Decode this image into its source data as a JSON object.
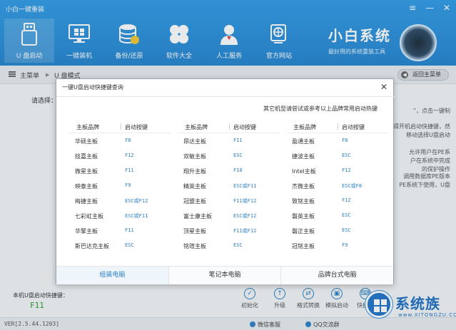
{
  "window": {
    "title": "小白一键重装",
    "controls": [
      "≡",
      "—",
      "✕"
    ]
  },
  "nav": [
    {
      "label": "U 盘启动",
      "icon": "usb-drive-icon",
      "active": true
    },
    {
      "label": "一键装机",
      "icon": "monitor-install-icon",
      "active": false
    },
    {
      "label": "备份/还原",
      "icon": "database-backup-icon",
      "active": false
    },
    {
      "label": "软件大全",
      "icon": "app-grid-icon",
      "active": false
    },
    {
      "label": "人工服务",
      "icon": "support-agent-icon",
      "active": false
    },
    {
      "label": "官方网站",
      "icon": "globe-icon",
      "active": false
    }
  ],
  "brand": {
    "name": "小白系统",
    "tagline": "最好用的系统重装工具"
  },
  "breadcrumb": {
    "home": "主菜单",
    "sep": "▶",
    "current": "U 盘模式",
    "back_label": "返回主菜单"
  },
  "main": {
    "select_label": "请选择：",
    "side_texts": [
      "”，点击一键制",
      "得开机启动快捷键，然",
      "移动选择U盘启动",
      "允许用户在PE系",
      "户在系统中完成",
      "的保护操作",
      "调用数据库PE版本",
      "PE系统下使用，U盘"
    ]
  },
  "modal": {
    "title": "一键U盘启动快捷键查询",
    "close": "✕",
    "note": "其它机型请尝试或参考以上品牌常用启动热键",
    "headers": {
      "brand": "主板品牌",
      "key": "启动按键"
    },
    "columns": [
      [
        {
          "brand": "华硕主板",
          "key": "F8"
        },
        {
          "brand": "技嘉主板",
          "key": "F12"
        },
        {
          "brand": "微星主板",
          "key": "F11"
        },
        {
          "brand": "映泰主板",
          "key": "F9"
        },
        {
          "brand": "梅捷主板",
          "key": "ESC或F12"
        },
        {
          "brand": "七彩虹主板",
          "key": "ESC或F11"
        },
        {
          "brand": "华擎主板",
          "key": "F11"
        },
        {
          "brand": "斯巴达克主板",
          "key": "ESC"
        }
      ],
      [
        {
          "brand": "昂达主板",
          "key": "F11"
        },
        {
          "brand": "双敏主板",
          "key": "ESC"
        },
        {
          "brand": "翔升主板",
          "key": "F10"
        },
        {
          "brand": "精英主板",
          "key": "ESC或F11"
        },
        {
          "brand": "冠盟主板",
          "key": "F11或F12"
        },
        {
          "brand": "富士康主板",
          "key": "ESC或F12"
        },
        {
          "brand": "顶星主板",
          "key": "F11或F12"
        },
        {
          "brand": "铭瑄主板",
          "key": "ESC"
        }
      ],
      [
        {
          "brand": "盈通主板",
          "key": "F8"
        },
        {
          "brand": "捷波主板",
          "key": "ESC"
        },
        {
          "brand": "Intel主板",
          "key": "F12"
        },
        {
          "brand": "杰微主板",
          "key": "ESC或F8"
        },
        {
          "brand": "致铭主板",
          "key": "F12"
        },
        {
          "brand": "磐英主板",
          "key": "ESC"
        },
        {
          "brand": "磐正主板",
          "key": "ESC"
        },
        {
          "brand": "冠铭主板",
          "key": "F9"
        }
      ]
    ],
    "tabs": [
      {
        "label": "组装电脑",
        "active": true
      },
      {
        "label": "笔记本电脑",
        "active": false
      },
      {
        "label": "品牌台式电脑",
        "active": false
      }
    ]
  },
  "bottom": {
    "hotkey_label": "本机U盘启动快捷键：",
    "hotkey_value": "F11",
    "tools": [
      {
        "label": "初始化",
        "icon": "check-icon"
      },
      {
        "label": "升级",
        "icon": "upgrade-arrow-icon"
      },
      {
        "label": "格式转换",
        "icon": "convert-icon"
      },
      {
        "label": "模拟启动",
        "icon": "simulate-boot-icon"
      },
      {
        "label": "快捷键",
        "icon": "keyboard-icon"
      }
    ]
  },
  "status": {
    "version": "VER[2.5.44.1203]",
    "wechat": "微信客服",
    "qq": "QQ交流群"
  },
  "watermark": {
    "text": "系统族",
    "url": "www.XITONGZU.COM"
  },
  "colors": {
    "header": "#2a8ed9",
    "accent": "#2c7fc4",
    "hotkey": "#2a9a2a"
  }
}
